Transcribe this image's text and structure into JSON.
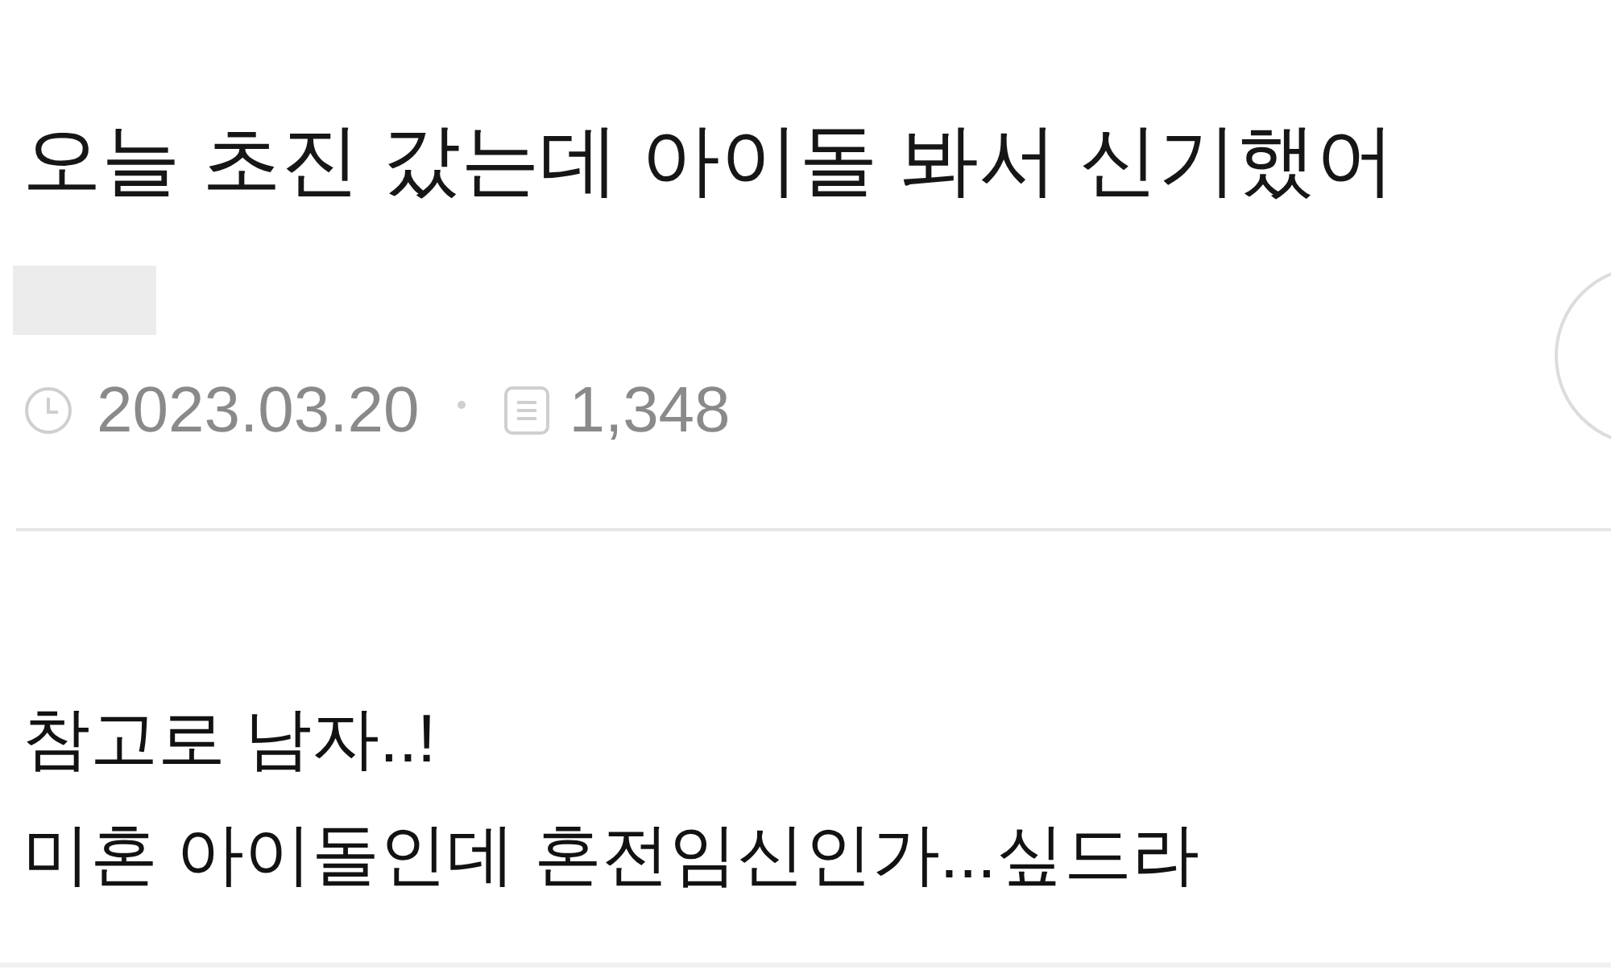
{
  "post": {
    "title": "오늘 초진 갔는데 아이돌 봐서 신기했어",
    "meta": {
      "date": "2023.03.20",
      "views": "1,348"
    },
    "body": [
      "참고로 남자..!",
      "미혼 아이돌인데 혼전임신인가...싶드라"
    ]
  }
}
